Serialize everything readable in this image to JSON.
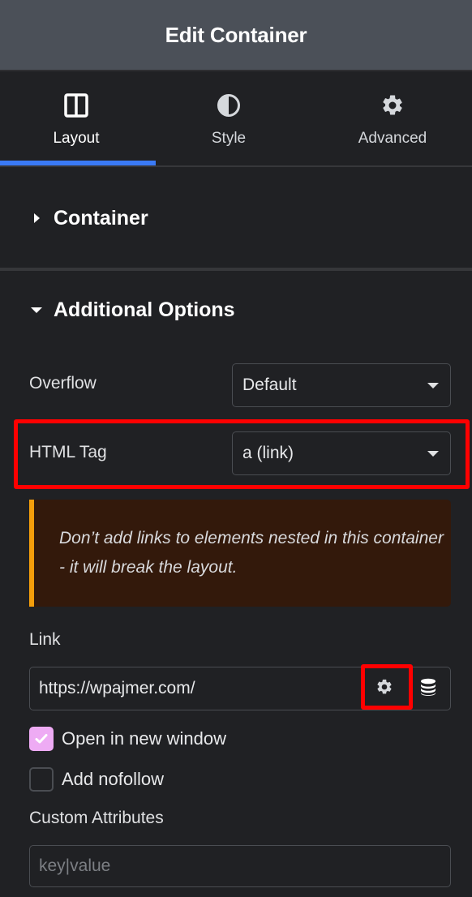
{
  "header": {
    "title": "Edit Container"
  },
  "tabs": [
    {
      "label": "Layout",
      "icon": "columns-icon",
      "active": true
    },
    {
      "label": "Style",
      "icon": "half-circle-icon",
      "active": false
    },
    {
      "label": "Advanced",
      "icon": "gear-icon",
      "active": false
    }
  ],
  "sections": {
    "container": {
      "title": "Container",
      "expanded": false
    },
    "additional": {
      "title": "Additional Options",
      "expanded": true
    }
  },
  "fields": {
    "overflow": {
      "label": "Overflow",
      "value": "Default"
    },
    "html_tag": {
      "label": "HTML Tag",
      "value": "a (link)"
    },
    "notice": "Don’t add links to elements nested in this container - it will break the layout.",
    "link": {
      "label": "Link",
      "value": "https://wpajmer.com/"
    },
    "open_new_window": {
      "label": "Open in new window",
      "checked": true
    },
    "nofollow": {
      "label": "Add nofollow",
      "checked": false
    },
    "custom_attributes": {
      "label": "Custom Attributes",
      "placeholder": "key|value",
      "value": ""
    }
  },
  "colors": {
    "accent": "#3a7af5",
    "highlight": "#ff0000",
    "notice_border": "#f59e0b",
    "checkbox_checked": "#eeabf4"
  }
}
